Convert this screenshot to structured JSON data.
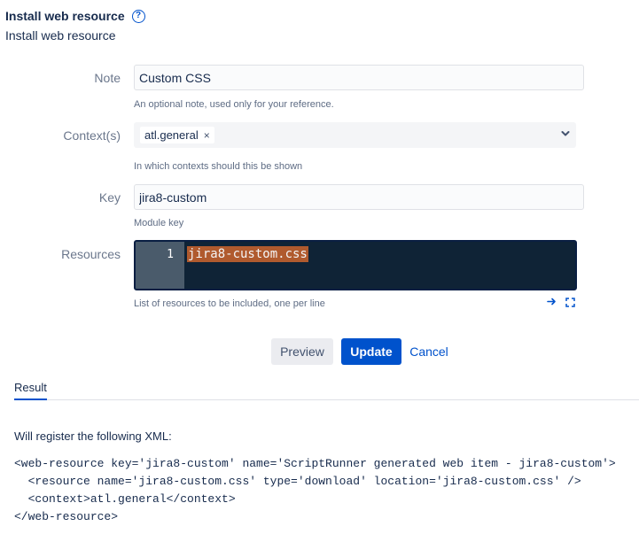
{
  "header": {
    "title": "Install web resource",
    "help_glyph": "?",
    "subtitle": "Install web resource"
  },
  "form": {
    "note": {
      "label": "Note",
      "value": "Custom CSS",
      "hint": "An optional note, used only for your reference."
    },
    "contexts": {
      "label": "Context(s)",
      "selected": [
        "atl.general"
      ],
      "remove_glyph": "×",
      "hint": "In which contexts should this be shown"
    },
    "key": {
      "label": "Key",
      "value": "jira8-custom",
      "hint": "Module key"
    },
    "resources": {
      "label": "Resources",
      "line_number": "1",
      "code": "jira8-custom.css",
      "hint": "List of resources to be included, one per line"
    }
  },
  "actions": {
    "preview_label": "Preview",
    "update_label": "Update",
    "cancel_label": "Cancel"
  },
  "result": {
    "tab_label": "Result",
    "intro": "Will register the following XML:",
    "xml_lines": [
      "<web-resource key='jira8-custom' name='ScriptRunner generated web item - jira8-custom'>",
      "  <resource name='jira8-custom.css' type='download' location='jira8-custom.css' />",
      "  <context>atl.general</context>",
      "</web-resource>"
    ]
  },
  "colors": {
    "primary": "#0052cc",
    "editor_bg": "#0f2336",
    "selection": "#b05a2e"
  }
}
